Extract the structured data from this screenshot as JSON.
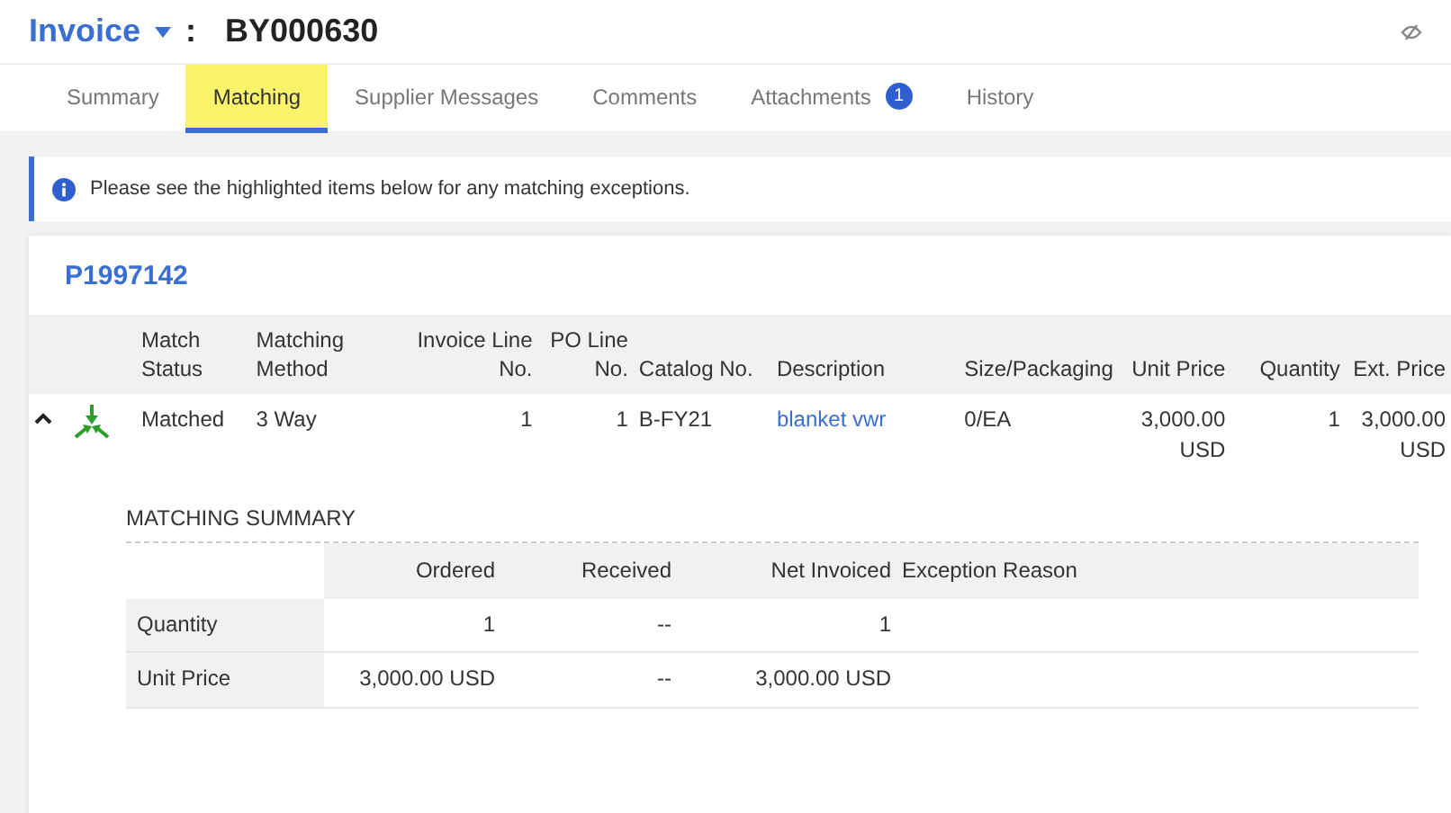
{
  "header": {
    "doc_type": "Invoice",
    "separator": ":",
    "number": "BY000630"
  },
  "tabs": [
    {
      "label": "Summary",
      "selected": false
    },
    {
      "label": "Matching",
      "selected": true
    },
    {
      "label": "Supplier Messages",
      "selected": false
    },
    {
      "label": "Comments",
      "selected": false
    },
    {
      "label": "Attachments",
      "selected": false,
      "badge": "1"
    },
    {
      "label": "History",
      "selected": false
    }
  ],
  "alert": {
    "text": "Please see the highlighted items below for any matching exceptions."
  },
  "order": {
    "number": "P1997142",
    "columns": [
      "Match Status",
      "Matching Method",
      "Invoice Line No.",
      "PO Line No.",
      "Catalog No.",
      "Description",
      "Size/Packaging",
      "Unit Price",
      "Quantity",
      "Ext. Price"
    ],
    "rows": [
      {
        "expanded": true,
        "cells": [
          {
            "text": "Matched"
          },
          {
            "text": "3 Way"
          },
          {
            "text": "1"
          },
          {
            "text": "1"
          },
          {
            "text": "B-FY21"
          },
          {
            "text": "blanket vwr",
            "kind": "link"
          },
          {
            "text": "0/EA"
          },
          {
            "text": "3,000.00 USD"
          },
          {
            "text": "1"
          },
          {
            "text": "3,000.00 USD"
          }
        ],
        "summary": {
          "title": "MATCHING SUMMARY",
          "columns": [
            "Ordered",
            "Received",
            "Net Invoiced",
            "Exception Reason"
          ],
          "rows": [
            {
              "label": "Quantity",
              "cells": [
                "1",
                "--",
                "1"
              ]
            },
            {
              "label": "Unit Price",
              "cells": [
                "3,000.00 USD",
                "--",
                "3,000.00 USD"
              ]
            }
          ]
        }
      }
    ]
  }
}
